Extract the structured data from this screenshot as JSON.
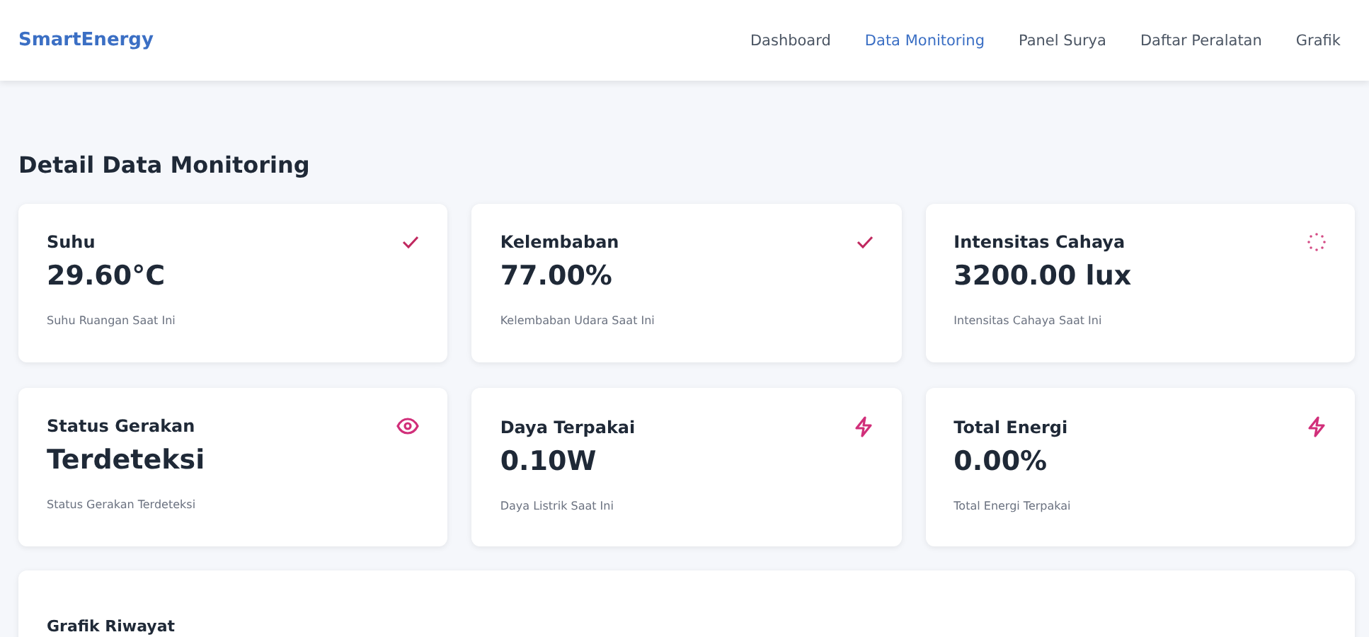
{
  "brand": "SmartEnergy",
  "nav": [
    {
      "label": "Dashboard",
      "selected": false
    },
    {
      "label": "Data Monitoring",
      "selected": true
    },
    {
      "label": "Panel Surya",
      "selected": false
    },
    {
      "label": "Daftar Peralatan",
      "selected": false
    },
    {
      "label": "Grafik",
      "selected": false
    }
  ],
  "page_title": "Detail Data Monitoring",
  "cards": [
    {
      "title": "Suhu",
      "value": "29.60°C",
      "caption": "Suhu Ruangan Saat Ini",
      "kind": "check"
    },
    {
      "title": "Kelembaban",
      "value": "77.00%",
      "caption": "Kelembaban Udara Saat Ini",
      "kind": "check"
    },
    {
      "title": "Intensitas Cahaya",
      "value": "3200.00 lux",
      "caption": "Intensitas Cahaya Saat Ini",
      "kind": "loading"
    },
    {
      "title": "Status Gerakan",
      "value": "Terdeteksi",
      "caption": "Status Gerakan Terdeteksi",
      "kind": "motion"
    },
    {
      "title": "Daya Terpakai",
      "value": "0.10W",
      "caption": "Daya Listrik Saat Ini",
      "kind": "power"
    },
    {
      "title": "Total Energi",
      "value": "0.00%",
      "caption": "Total Energi Terpakai",
      "kind": "power"
    }
  ],
  "history": {
    "title": "Grafik Riwayat"
  }
}
